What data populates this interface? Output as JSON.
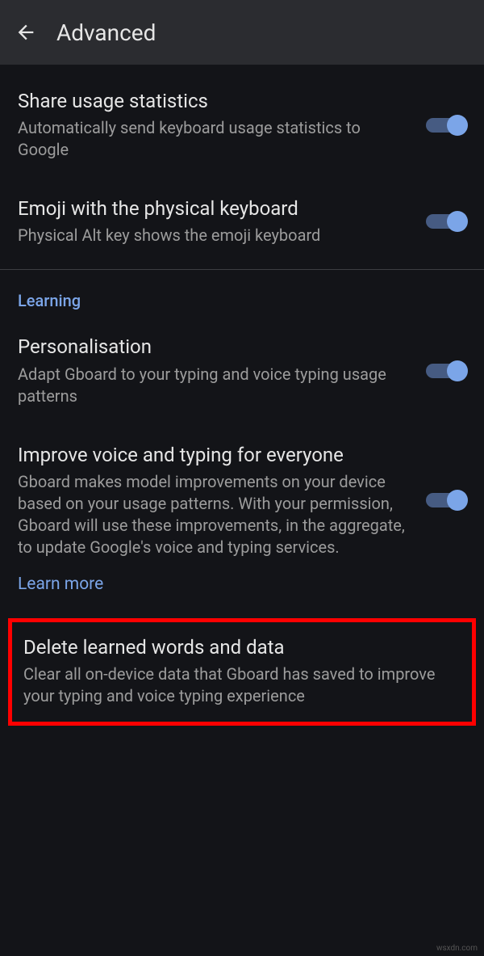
{
  "header": {
    "title": "Advanced"
  },
  "items": [
    {
      "title": "Share usage statistics",
      "desc": "Automatically send keyboard usage statistics to Google"
    },
    {
      "title": "Emoji with the physical keyboard",
      "desc": "Physical Alt key shows the emoji keyboard"
    }
  ],
  "section": {
    "header": "Learning"
  },
  "learning": [
    {
      "title": "Personalisation",
      "desc": "Adapt Gboard to your typing and voice typing usage patterns"
    },
    {
      "title": "Improve voice and typing for everyone",
      "desc": "Gboard makes model improvements on your device based on your usage patterns. With your permission, Gboard will use these improvements, in the aggregate, to update Google's voice and typing services."
    }
  ],
  "learn_more": "Learn more",
  "delete": {
    "title": "Delete learned words and data",
    "desc": "Clear all on-device data that Gboard has saved to improve your typing and voice typing experience"
  },
  "watermark": "wsxdn.com"
}
